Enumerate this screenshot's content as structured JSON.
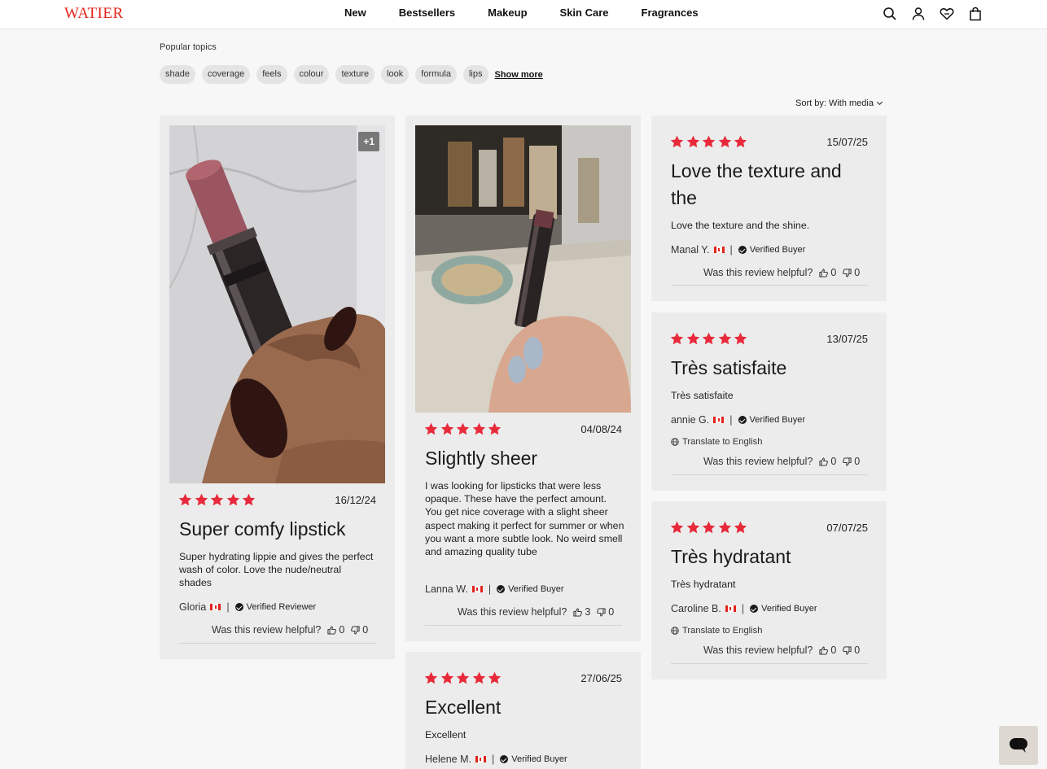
{
  "header": {
    "logo": "WATIER",
    "nav": [
      "New",
      "Bestsellers",
      "Makeup",
      "Skin Care",
      "Fragrances"
    ],
    "icons": [
      "search-icon",
      "account-icon",
      "wishlist-heart-icon",
      "shopping-bag-icon"
    ]
  },
  "topics": {
    "title": "Popular topics",
    "chips": [
      "shade",
      "coverage",
      "feels",
      "colour",
      "texture",
      "look",
      "formula",
      "lips"
    ],
    "show_more": "Show more"
  },
  "sort": {
    "label": "Sort by: With media"
  },
  "helpful_label": "Was this review helpful?",
  "colors": {
    "brand": "#e2231a",
    "star": "#e8293a",
    "card_bg": "#ececec",
    "page_bg": "#f7f7f7"
  },
  "reviews": [
    {
      "rating": 5,
      "date": "16/12/24",
      "title": "Super comfy lipstick",
      "body": "Super hydrating lippie and gives the perfect wash of color. Love the nude/neutral shades",
      "author": "Gloria",
      "badge": "Verified Reviewer",
      "up": "0",
      "down": "0",
      "extra_photos": "+1"
    },
    {
      "rating": 5,
      "date": "04/08/24",
      "title": "Slightly sheer",
      "body": "I was looking for lipsticks that were less opaque. These have the perfect amount. You get nice coverage with a slight sheer aspect making it perfect for summer or when you want a more subtle look. No weird smell and amazing quality tube",
      "author": "Lanna W.",
      "badge": "Verified Buyer",
      "up": "3",
      "down": "0"
    },
    {
      "rating": 5,
      "date": "27/06/25",
      "title": "Excellent",
      "body": "Excellent",
      "author": "Helene M.",
      "badge": "Verified Buyer"
    },
    {
      "rating": 5,
      "date": "15/07/25",
      "title": "Love the texture and the",
      "body": "Love the texture and the shine.",
      "author": "Manal Y.",
      "badge": "Verified Buyer",
      "up": "0",
      "down": "0"
    },
    {
      "rating": 5,
      "date": "13/07/25",
      "title": "Très satisfaite",
      "body": "Très satisfaite",
      "author": "annie G.",
      "badge": "Verified Buyer",
      "translate": "Translate to English",
      "up": "0",
      "down": "0"
    },
    {
      "rating": 5,
      "date": "07/07/25",
      "title": "Très hydratant",
      "body": "Très hydratant",
      "author": "Caroline B.",
      "badge": "Verified Buyer",
      "translate": "Translate to English",
      "up": "0",
      "down": "0"
    }
  ]
}
